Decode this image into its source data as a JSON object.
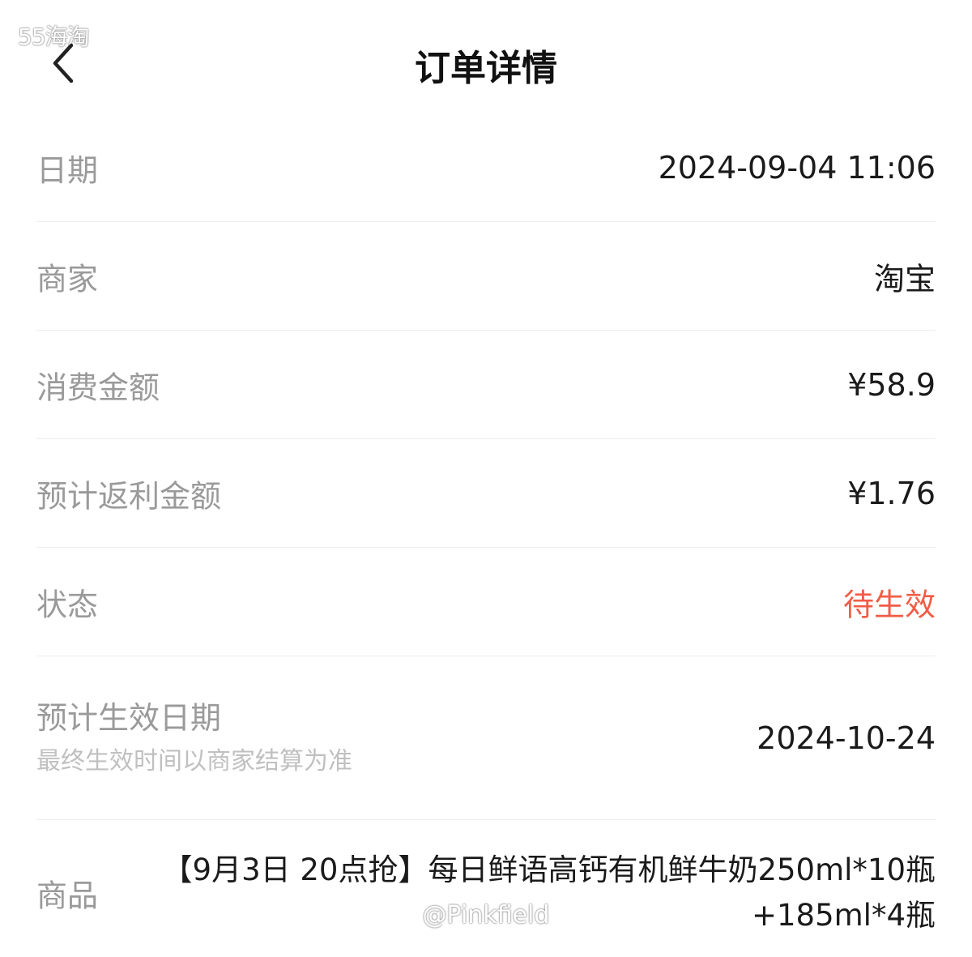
{
  "watermark_top": "55海淘",
  "watermark_bottom": "@Pinkfield",
  "header": {
    "title": "订单详情",
    "back_icon": "chevron-left-icon"
  },
  "rows": {
    "date": {
      "label": "日期",
      "value": "2024-09-04 11:06"
    },
    "merchant": {
      "label": "商家",
      "value": "淘宝"
    },
    "amount": {
      "label": "消费金额",
      "value": "¥58.9"
    },
    "rebate": {
      "label": "预计返利金额",
      "value": "¥1.76"
    },
    "status": {
      "label": "状态",
      "value": "待生效"
    },
    "effective_date": {
      "label": "预计生效日期",
      "sublabel": "最终生效时间以商家结算为准",
      "value": "2024-10-24"
    },
    "product": {
      "label": "商品",
      "value": "【9月3日 20点抢】每日鲜语高钙有机鲜牛奶250ml*10瓶+185ml*4瓶"
    }
  },
  "colors": {
    "status_pending": "#f25c45",
    "label_gray": "#9a9a9a",
    "value_dark": "#1a1a1a"
  }
}
